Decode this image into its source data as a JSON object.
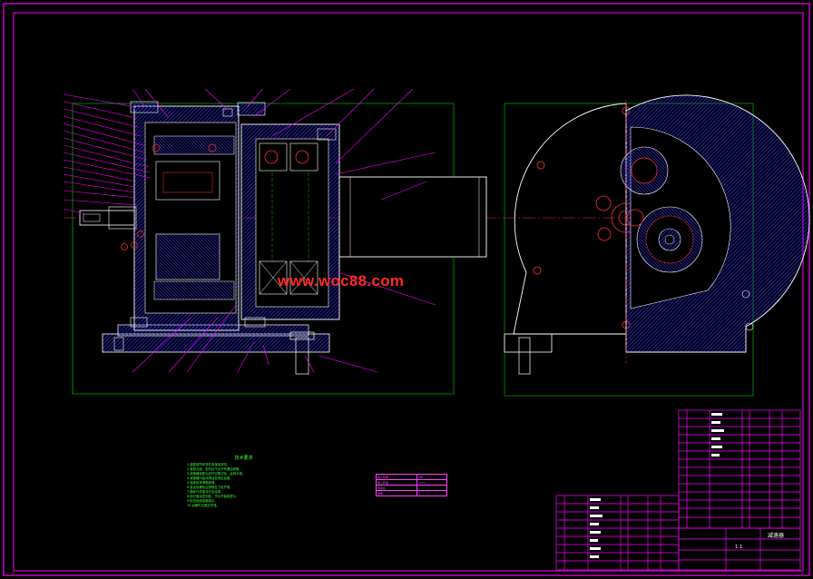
{
  "drawing": {
    "watermark": "www.woc88.com",
    "notes_title": "技术要求",
    "notes_lines": [
      "1.装配前所有零件用煤油清洗。",
      "2.各配合面、密封处不允许有漏油现象。",
      "3.减速器装配后应作空载试验，运转平稳。",
      "4.减速器内装润滑油至规定高度。",
      "5.轴承用润滑脂润滑。",
      "6.各连接螺栓应按规定力矩拧紧。",
      "7.箱体外表面涂灰色油漆。",
      "8.剖分面涂密封胶，不允许使用垫片。",
      "9.检查齿面接触斑点。",
      "10.运输时应固定牢靠。"
    ],
    "spec_table": [
      [
        "输入功率",
        "kW"
      ],
      [
        "输入转速",
        "r/min"
      ],
      [
        "传动比",
        "i"
      ],
      [
        "效率",
        "η"
      ]
    ],
    "title_block": {
      "name": "减速器",
      "scale": "1:1"
    },
    "colors": {
      "frame": "#ff00ff",
      "outline": "#ffffff",
      "section": "#2020ff",
      "leader": "#ff00ff",
      "hidden": "#ff3030",
      "dimension": "#00c000"
    }
  }
}
